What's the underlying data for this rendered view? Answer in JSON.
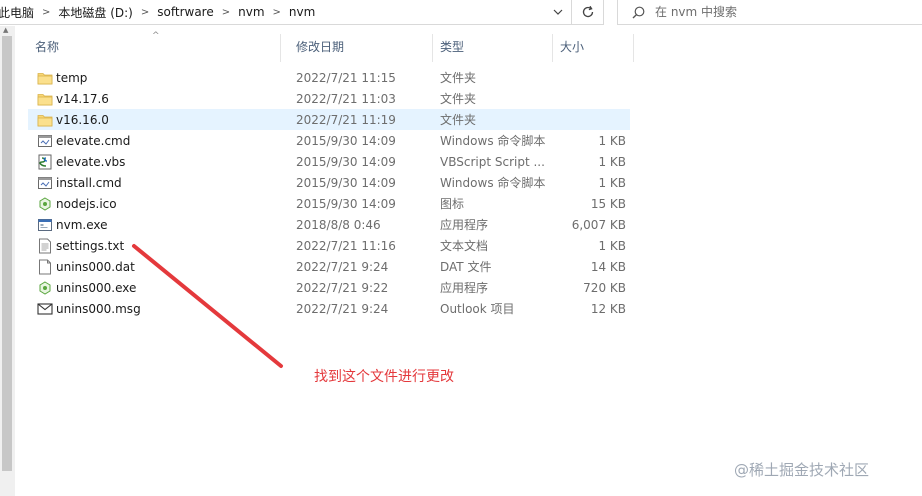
{
  "address_bar": {
    "crumbs": [
      "此电脑",
      "本地磁盘 (D:)",
      "softrware",
      "nvm",
      "nvm"
    ]
  },
  "search": {
    "placeholder": "在 nvm 中搜索"
  },
  "columns": {
    "name": "名称",
    "date": "修改日期",
    "type": "类型",
    "size": "大小"
  },
  "files": [
    {
      "icon": "folder-icon",
      "name": "temp",
      "date": "2022/7/21 11:15",
      "type": "文件夹",
      "size": ""
    },
    {
      "icon": "folder-icon",
      "name": "v14.17.6",
      "date": "2022/7/21 11:03",
      "type": "文件夹",
      "size": ""
    },
    {
      "icon": "folder-icon",
      "name": "v16.16.0",
      "date": "2022/7/21 11:19",
      "type": "文件夹",
      "size": "",
      "selected": true
    },
    {
      "icon": "cmd-file-icon",
      "name": "elevate.cmd",
      "date": "2015/9/30 14:09",
      "type": "Windows 命令脚本",
      "size": "1 KB"
    },
    {
      "icon": "vbs-file-icon",
      "name": "elevate.vbs",
      "date": "2015/9/30 14:09",
      "type": "VBScript Script ...",
      "size": "1 KB"
    },
    {
      "icon": "cmd-file-icon",
      "name": "install.cmd",
      "date": "2015/9/30 14:09",
      "type": "Windows 命令脚本",
      "size": "1 KB"
    },
    {
      "icon": "ico-file-icon",
      "name": "nodejs.ico",
      "date": "2015/9/30 14:09",
      "type": "图标",
      "size": "15 KB"
    },
    {
      "icon": "exe-file-icon",
      "name": "nvm.exe",
      "date": "2018/8/8 0:46",
      "type": "应用程序",
      "size": "6,007 KB"
    },
    {
      "icon": "txt-file-icon",
      "name": "settings.txt",
      "date": "2022/7/21 11:16",
      "type": "文本文档",
      "size": "1 KB"
    },
    {
      "icon": "blank-file-icon",
      "name": "unins000.dat",
      "date": "2022/7/21 9:24",
      "type": "DAT 文件",
      "size": "14 KB"
    },
    {
      "icon": "node-exe-icon",
      "name": "unins000.exe",
      "date": "2022/7/21 9:22",
      "type": "应用程序",
      "size": "720 KB"
    },
    {
      "icon": "msg-file-icon",
      "name": "unins000.msg",
      "date": "2022/7/21 9:24",
      "type": "Outlook 项目",
      "size": "12 KB"
    }
  ],
  "annotation": {
    "text": "找到这个文件进行更改"
  },
  "watermark": {
    "text": "@稀土掘金技术社区"
  },
  "colors": {
    "selection": "#e5f3ff",
    "folder": "#f8d775",
    "annotation": "#e4393c",
    "node_green": "#5aa63f"
  }
}
